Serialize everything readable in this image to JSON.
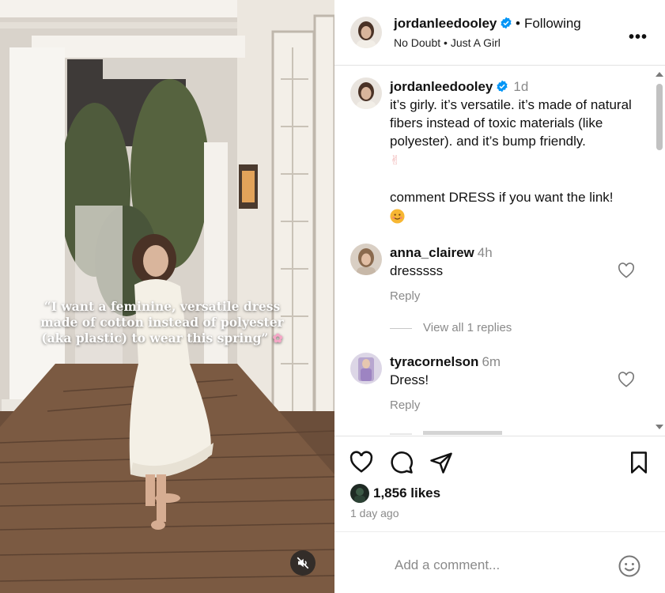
{
  "media": {
    "overlay_caption": "“I want a feminine, versatile dress made of cotton instead of polyester (aka plastic) to wear this spring”",
    "overlay_emoji": "✿",
    "mute_icon": "speaker-muted-icon"
  },
  "header": {
    "username": "jordanleedooley",
    "follow_separator": "•",
    "follow_label": "Following",
    "audio": "No Doubt • Just A Girl",
    "more": "•••"
  },
  "post": {
    "username": "jordanleedooley",
    "time": "1d",
    "caption_line1": "it’s girly. it’s versatile. it’s made of natural fibers instead of toxic materials (like polyester). and it’s bump friendly.",
    "emoji_1": "✌",
    "caption_line2": "comment DRESS if you want the link!"
  },
  "comments": [
    {
      "username": "anna_clairew",
      "time": "4h",
      "text": "dresssss",
      "reply": "Reply"
    },
    {
      "username": "tyracornelson",
      "time": "6m",
      "text": "Dress!",
      "reply": "Reply"
    }
  ],
  "view_replies": "View all 1 replies",
  "actions": {
    "likes": "1,856 likes",
    "date": "1 day ago"
  },
  "add_comment": {
    "placeholder": "Add a comment..."
  },
  "colors": {
    "verified": "#0095f6",
    "muted_text": "#8a8a8a",
    "border": "#e3e3e3"
  }
}
